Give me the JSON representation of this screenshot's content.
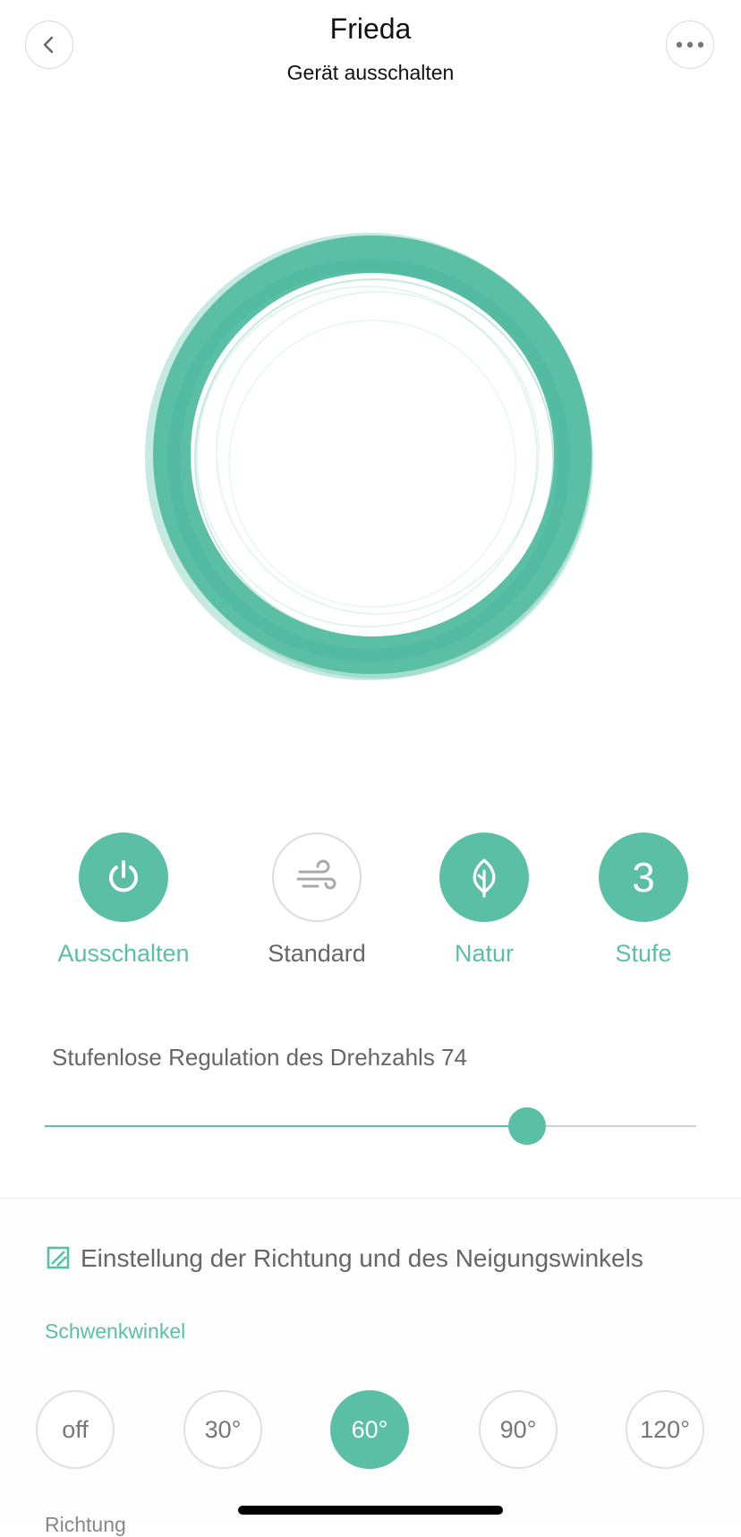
{
  "header": {
    "title": "Frieda",
    "subtitle": "Gerät ausschalten",
    "back_icon": "chevron-left-icon",
    "more_icon": "more-horizontal-icon"
  },
  "modes": [
    {
      "label": "Ausschalten",
      "icon": "power-icon",
      "active": true
    },
    {
      "label": "Standard",
      "icon": "wind-icon",
      "active": false
    },
    {
      "label": "Natur",
      "icon": "leaf-icon",
      "active": true
    },
    {
      "label": "Stufe",
      "value": "3",
      "active": true
    }
  ],
  "speed": {
    "label": "Stufenlose Regulation des Drehzahls 74",
    "value": 74,
    "max": 100
  },
  "direction": {
    "title": "Einstellung der Richtung und des Neigungswinkels",
    "swing_label": "Schwenkwinkel",
    "angles": [
      "off",
      "30°",
      "60°",
      "90°",
      "120°"
    ],
    "selected_angle": "60°",
    "direction_label": "Richtung"
  },
  "colors": {
    "accent": "#5bbfa5",
    "text_muted": "#666666",
    "border": "#dcdcdc"
  }
}
